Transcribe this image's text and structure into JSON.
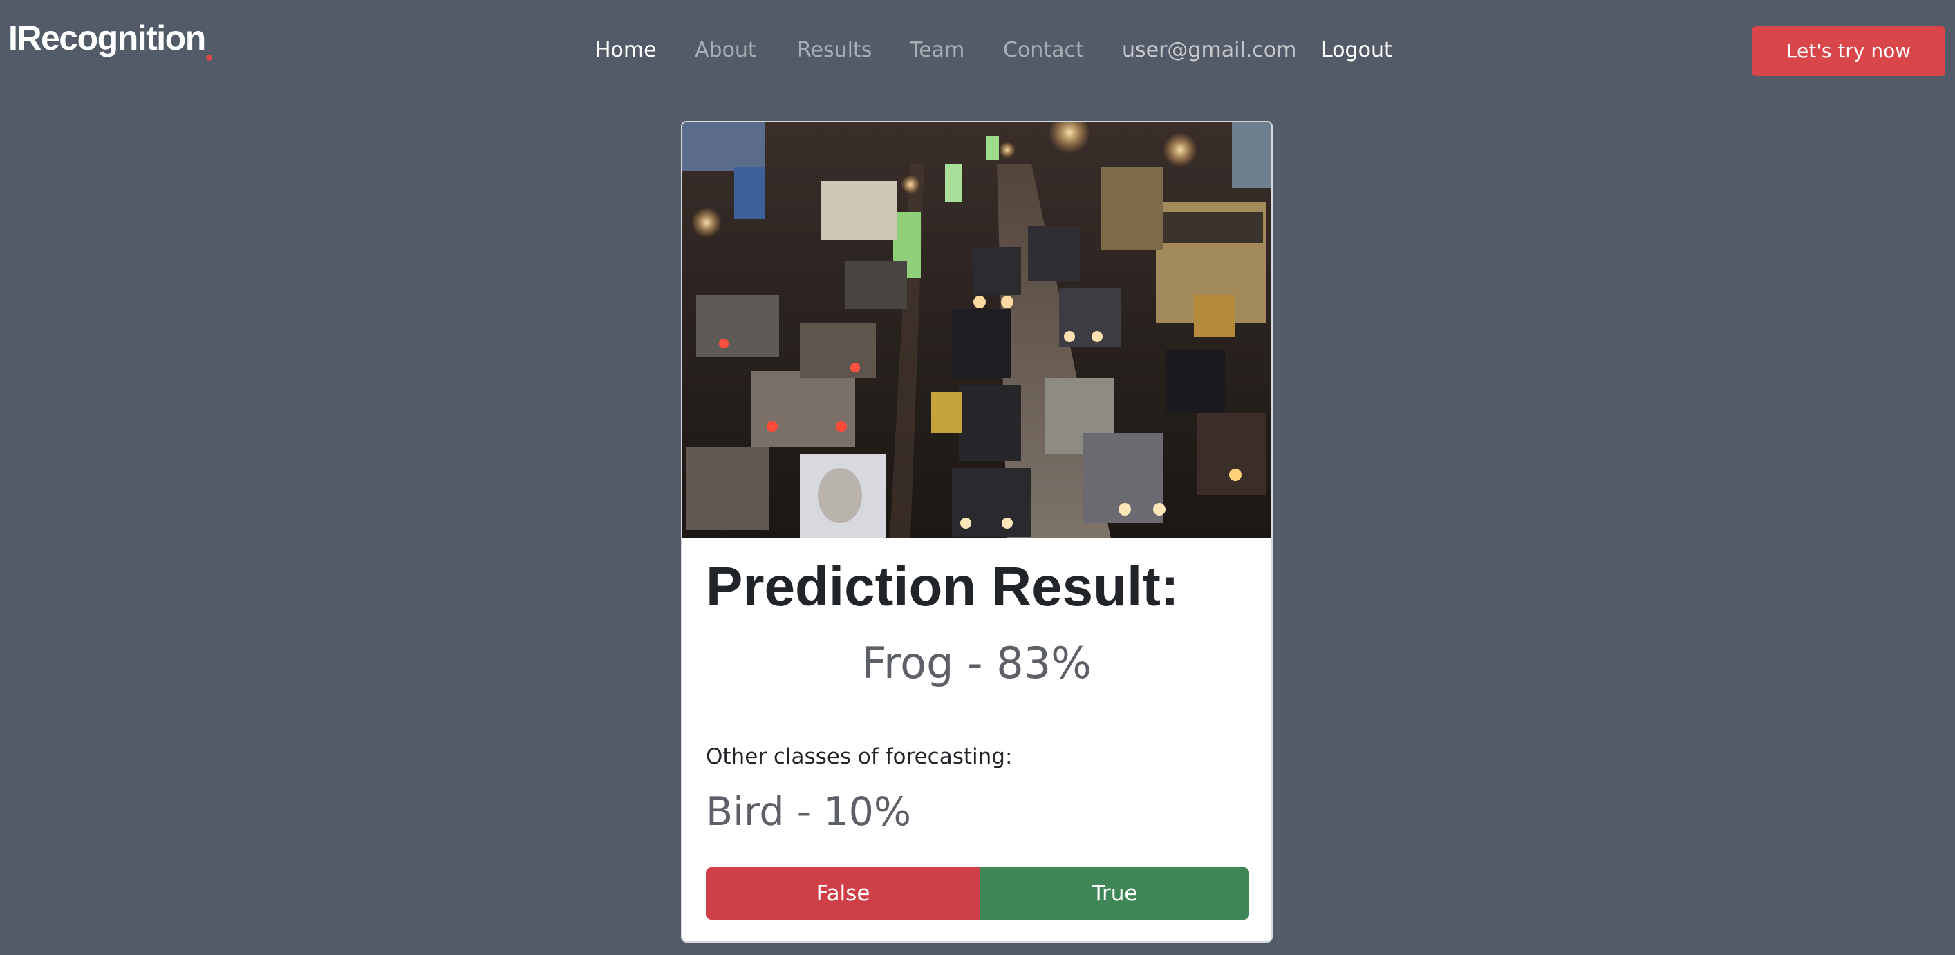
{
  "brand": {
    "name": "IRecognition",
    "dot_color": "#d9464a"
  },
  "nav": {
    "items": [
      {
        "label": "Home",
        "state": "active"
      },
      {
        "label": "About",
        "state": "inactive"
      },
      {
        "label": "Results",
        "state": "inactive"
      },
      {
        "label": "Team",
        "state": "inactive"
      },
      {
        "label": "Contact",
        "state": "inactive"
      },
      {
        "label": "user@gmail.com",
        "state": "user"
      },
      {
        "label": "Logout",
        "state": "action"
      }
    ],
    "cta_label": "Let's try now",
    "cta_color": "#d9464a"
  },
  "result": {
    "image_icon": "uploaded-photo-night-traffic",
    "title": "Prediction Result:",
    "main_prediction": "Frog - 83%",
    "other_label": "Other classes of forecasting:",
    "other_prediction": "Bird - 10%",
    "false_label": "False",
    "true_label": "True",
    "false_color": "#cf3f47",
    "true_color": "#3f8657"
  },
  "theme": {
    "background": "#545b68",
    "card_background": "#ffffff"
  }
}
